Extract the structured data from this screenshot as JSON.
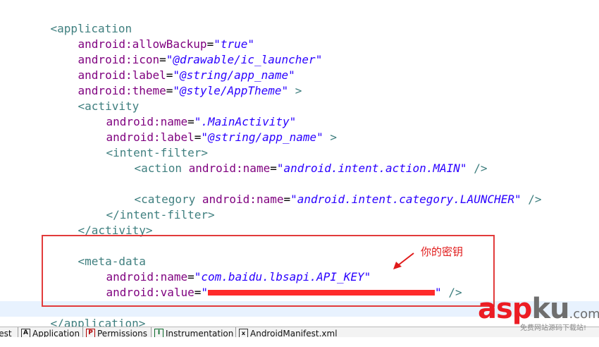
{
  "editor": {
    "lines": [
      {
        "id": "app-open",
        "tag": "<application"
      },
      {
        "id": "allow-backup",
        "attr": "android:allowBackup",
        "value": "\"true\""
      },
      {
        "id": "icon",
        "attr": "android:icon",
        "value": "\"@drawable/ic_launcher\""
      },
      {
        "id": "label",
        "attr": "android:label",
        "value": "\"@string/app_name\""
      },
      {
        "id": "theme",
        "attr": "android:theme",
        "value": "\"@style/AppTheme\"",
        "suffix": " >"
      },
      {
        "id": "activity-open",
        "tag": "<activity"
      },
      {
        "id": "activity-name",
        "attr": "android:name",
        "value": "\".MainActivity\""
      },
      {
        "id": "activity-label",
        "attr": "android:label",
        "value": "\"@string/app_name\"",
        "suffix": " >"
      },
      {
        "id": "intent-open",
        "tag": "<intent-filter>"
      },
      {
        "id": "action-tag",
        "tag": "<action",
        "attr": "android:name",
        "value": "\"android.intent.action.MAIN\"",
        "suffix": " />"
      },
      {
        "id": "category-tag",
        "tag": "<category",
        "attr": "android:name",
        "value": "\"android.intent.category.LAUNCHER\"",
        "suffix": " />"
      },
      {
        "id": "intent-close",
        "tag": "</intent-filter>"
      },
      {
        "id": "activity-close",
        "tag": "</activity>"
      },
      {
        "id": "meta-open",
        "tag": "<meta-data"
      },
      {
        "id": "meta-name",
        "attr": "android:name",
        "value": "\"com.baidu.lbsapi.API_KEY\""
      },
      {
        "id": "meta-value",
        "attr": "android:value",
        "value_open": "\"",
        "value_close": "\"",
        "suffix": " />"
      },
      {
        "id": "app-close",
        "tag": "</application>"
      }
    ]
  },
  "annotation": {
    "text": "你的密钥"
  },
  "tabs": [
    {
      "label": "fest",
      "icon": ""
    },
    {
      "label": "Application",
      "icon": "A"
    },
    {
      "label": "Permissions",
      "icon": "P"
    },
    {
      "label": "Instrumentation",
      "icon": "I"
    },
    {
      "label": "AndroidManifest.xml",
      "icon": "x"
    }
  ],
  "watermark": {
    "a": "asp",
    "b": "ku",
    "c": ".com",
    "sub": "免费网站源码下载站!"
  },
  "colors": {
    "tag": "#3f7f7f",
    "attr": "#7f007f",
    "value": "#2a00ff",
    "highlight": "#e23b3b",
    "annotation": "#e01a1a"
  }
}
